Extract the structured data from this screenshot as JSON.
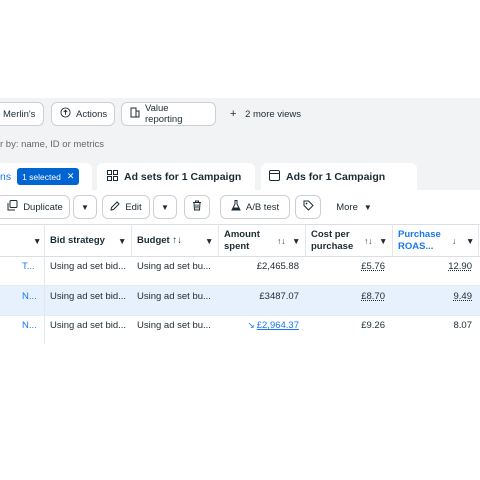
{
  "view_bar": {
    "merlin_label": "Merlin's",
    "actions_label": "Actions",
    "value_reporting_label": "Value reporting",
    "more_views_label": "2 more views"
  },
  "filter": {
    "placeholder": "r by: name, ID or metrics"
  },
  "tabs": {
    "campaigns_label": "ns",
    "selected_badge": "1 selected",
    "adsets_label": "Ad sets for 1 Campaign",
    "ads_label": "Ads for 1 Campaign"
  },
  "toolbar": {
    "duplicate_label": "Duplicate",
    "edit_label": "Edit",
    "ab_test_label": "A/B test",
    "more_label": "More"
  },
  "table": {
    "headers": {
      "bid_strategy": "Bid strategy",
      "budget": "Budget",
      "amount_spent_1": "Amount",
      "amount_spent_2": "spent",
      "cost_per_purchase_1": "Cost per",
      "cost_per_purchase_2": "purchase",
      "purchase_roas_1": "Purchase",
      "purchase_roas_2": "ROAS..."
    },
    "rows": [
      {
        "name": "T...",
        "bid": "Using ad set bid...",
        "budget": "Using ad set bu...",
        "spent": "£2,465.88",
        "cpp": "£5.76",
        "roas": "12.90",
        "highlight": false
      },
      {
        "name": "N...",
        "bid": "Using ad set bid...",
        "budget": "Using ad set bu...",
        "spent": "£3487.07",
        "cpp": "£8.70",
        "roas": "9.49",
        "highlight": true
      },
      {
        "name": "N...",
        "bid": "Using ad set bid...",
        "budget": "Using ad set bu...",
        "spent": "£2,964.37",
        "cpp": "£9.26",
        "roas": "8.07",
        "highlight": false
      }
    ]
  },
  "colors": {
    "accent": "#1877f2",
    "selected_bg": "#0064d1",
    "row_highlight": "#e7f0fd"
  }
}
